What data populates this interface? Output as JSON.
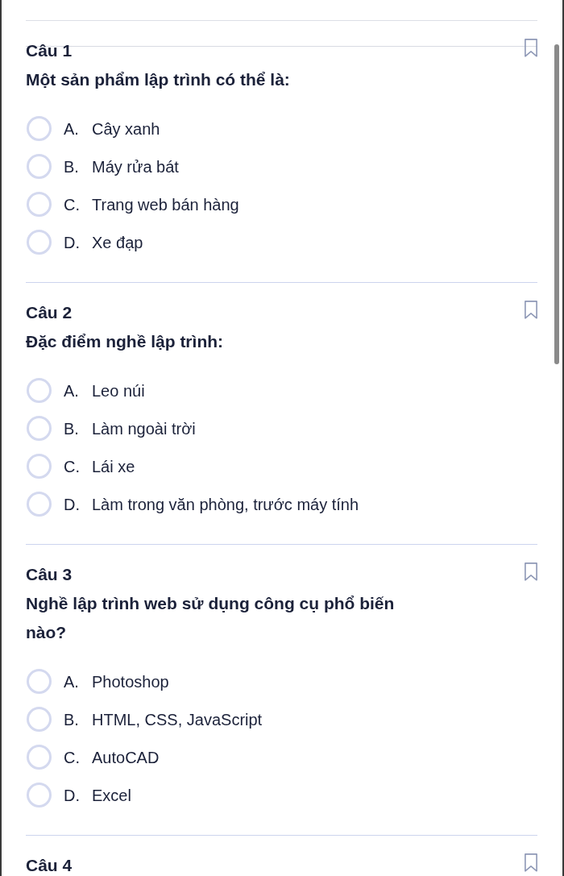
{
  "questions": [
    {
      "title": "Câu 1",
      "bookmarked": false,
      "text": "Một sản phẩm lập trình có thể là:",
      "options": [
        {
          "letter": "A.",
          "text": "Cây xanh",
          "selected": false
        },
        {
          "letter": "B.",
          "text": "Máy rửa bát",
          "selected": false
        },
        {
          "letter": "C.",
          "text": "Trang web bán hàng",
          "selected": false
        },
        {
          "letter": "D.",
          "text": "Xe đạp",
          "selected": false
        }
      ]
    },
    {
      "title": "Câu 2",
      "bookmarked": false,
      "text": "Đặc điểm nghề lập trình:",
      "options": [
        {
          "letter": "A.",
          "text": "Leo núi",
          "selected": false
        },
        {
          "letter": "B.",
          "text": "Làm ngoài trời",
          "selected": false
        },
        {
          "letter": "C.",
          "text": "Lái xe",
          "selected": false
        },
        {
          "letter": "D.",
          "text": "Làm trong văn phòng, trước máy tính",
          "selected": false
        }
      ]
    },
    {
      "title": "Câu 3",
      "bookmarked": false,
      "text": "Nghề lập trình web sử dụng công cụ phổ biến nào?",
      "options": [
        {
          "letter": "A.",
          "text": "Photoshop",
          "selected": false
        },
        {
          "letter": "B.",
          "text": "HTML, CSS, JavaScript",
          "selected": false
        },
        {
          "letter": "C.",
          "text": "AutoCAD",
          "selected": false
        },
        {
          "letter": "D.",
          "text": "Excel",
          "selected": false
        }
      ]
    },
    {
      "title": "Câu 4",
      "bookmarked": false
    }
  ]
}
